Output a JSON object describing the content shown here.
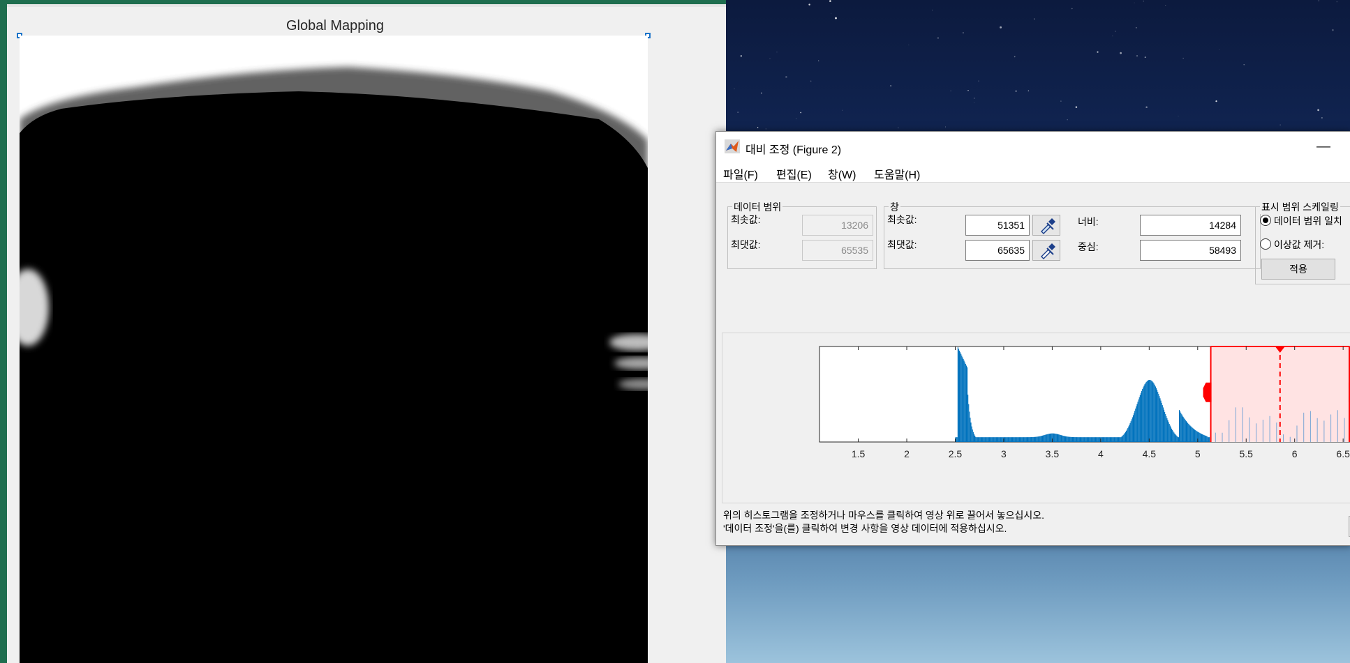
{
  "figure1": {
    "title": "Global Mapping"
  },
  "figure2": {
    "window_title": "대비 조정 (Figure 2)",
    "minimize_glyph": "—",
    "menu": [
      "파일(F)",
      "편집(E)",
      "창(W)",
      "도움말(H)"
    ],
    "data_range": {
      "group_title": "데이터 범위",
      "min_label": "최솟값:",
      "min_value": "13206",
      "max_label": "최댓값:",
      "max_value": "65535"
    },
    "window": {
      "group_title": "창",
      "min_label": "최솟값:",
      "min_value": "51351",
      "max_label": "최댓값:",
      "max_value": "65635",
      "width_label": "너비:",
      "width_value": "14284",
      "center_label": "중심:",
      "center_value": "58493"
    },
    "scaling": {
      "group_title": "표시 범위 스케일링",
      "option_match": "데이터 범위 일치",
      "option_match_checked": true,
      "option_outliers": "이상값 제거:",
      "apply_button": "적용"
    },
    "status": {
      "line1": "위의 히스토그램을 조정하거나 마우스를 클릭하여 영상 위로 끌어서 놓으십시오.",
      "line2": "'데이터 조정'을(를) 클릭하여 변경 사항을 영상 데이터에 적용하십시오."
    }
  },
  "chart_data": {
    "type": "bar",
    "title": "",
    "xlabel": "",
    "ylabel": "",
    "x_tick_labels": [
      "1.5",
      "2",
      "2.5",
      "3",
      "3.5",
      "4",
      "4.5",
      "5",
      "5.5",
      "6",
      "6.5"
    ],
    "x_ticks": [
      1.5,
      2,
      2.5,
      3,
      3.5,
      4,
      4.5,
      5,
      5.5,
      6,
      6.5
    ],
    "exponent_label": "×",
    "xlim": [
      1.1,
      6.65
    ],
    "ylim": [
      0,
      1
    ],
    "peaks": [
      {
        "x": 2.54,
        "y": 1.0
      },
      {
        "x": 2.6,
        "y": 0.75
      },
      {
        "x": 4.5,
        "y": 0.65
      }
    ],
    "window_min": 5.1351,
    "window_max": 6.5635,
    "window_center": 5.8493,
    "colors": {
      "bars": "#0072bd",
      "window_line": "#ff0000",
      "window_fill": "#ffe3e3"
    }
  }
}
